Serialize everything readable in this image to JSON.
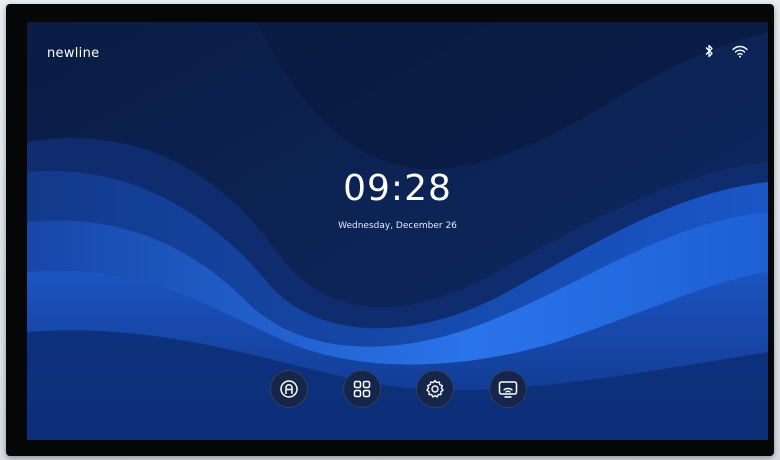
{
  "device": {
    "brand": "newline"
  },
  "status_bar": {
    "icons": [
      "bluetooth-icon",
      "wifi-icon"
    ]
  },
  "home": {
    "time": "09:28",
    "date": "Wednesday, December 26"
  },
  "dock": {
    "items": [
      {
        "icon": "whiteboard-pen-icon"
      },
      {
        "icon": "apps-grid-icon"
      },
      {
        "icon": "settings-gear-icon"
      },
      {
        "icon": "screen-share-icon"
      }
    ]
  },
  "colors": {
    "bezel": "#050608",
    "wallpaper_dark": "#0c1f4a",
    "wallpaper_light": "#1f6ae0",
    "dock_button": "#15264a",
    "text": "#ffffff"
  }
}
